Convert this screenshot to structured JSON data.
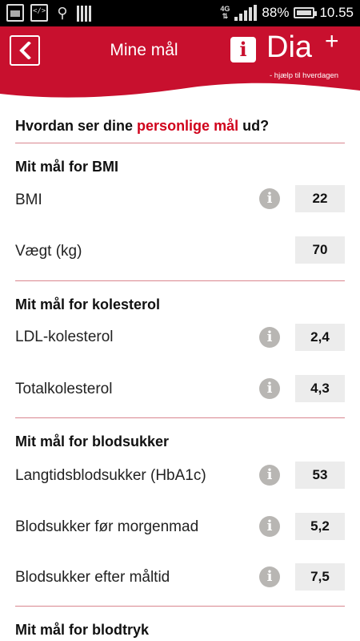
{
  "status_bar": {
    "network": "4G",
    "battery": "88%",
    "time": "10.55"
  },
  "header": {
    "back_icon": "chevron-left-icon",
    "title": "Mine mål",
    "info_icon": "i",
    "logo_text": "Dia",
    "logo_plus": "+",
    "logo_tagline": "- hjælp til hverdagen",
    "brand_color": "#c8102e"
  },
  "question": {
    "prefix": "Hvordan ser dine ",
    "highlight": "personlige mål",
    "suffix": " ud?"
  },
  "sections": [
    {
      "title": "Mit mål for BMI",
      "rows": [
        {
          "label": "BMI",
          "value": "22",
          "info": "i"
        },
        {
          "label": "Vægt (kg)",
          "value": "70"
        }
      ]
    },
    {
      "title": "Mit mål for kolesterol",
      "rows": [
        {
          "label": "LDL-kolesterol",
          "value": "2,4",
          "info": "i"
        },
        {
          "label": "Totalkolesterol",
          "value": "4,3",
          "info": "i"
        }
      ]
    },
    {
      "title": "Mit mål for blodsukker",
      "rows": [
        {
          "label": "Langtidsblodsukker (HbA1c)",
          "value": "53",
          "info": "i"
        },
        {
          "label": "Blodsukker før morgenmad",
          "value": "5,2",
          "info": "i"
        },
        {
          "label": "Blodsukker efter måltid",
          "value": "7,5",
          "info": "i"
        }
      ]
    },
    {
      "title": "Mit mål for blodtryk",
      "rows": []
    }
  ]
}
